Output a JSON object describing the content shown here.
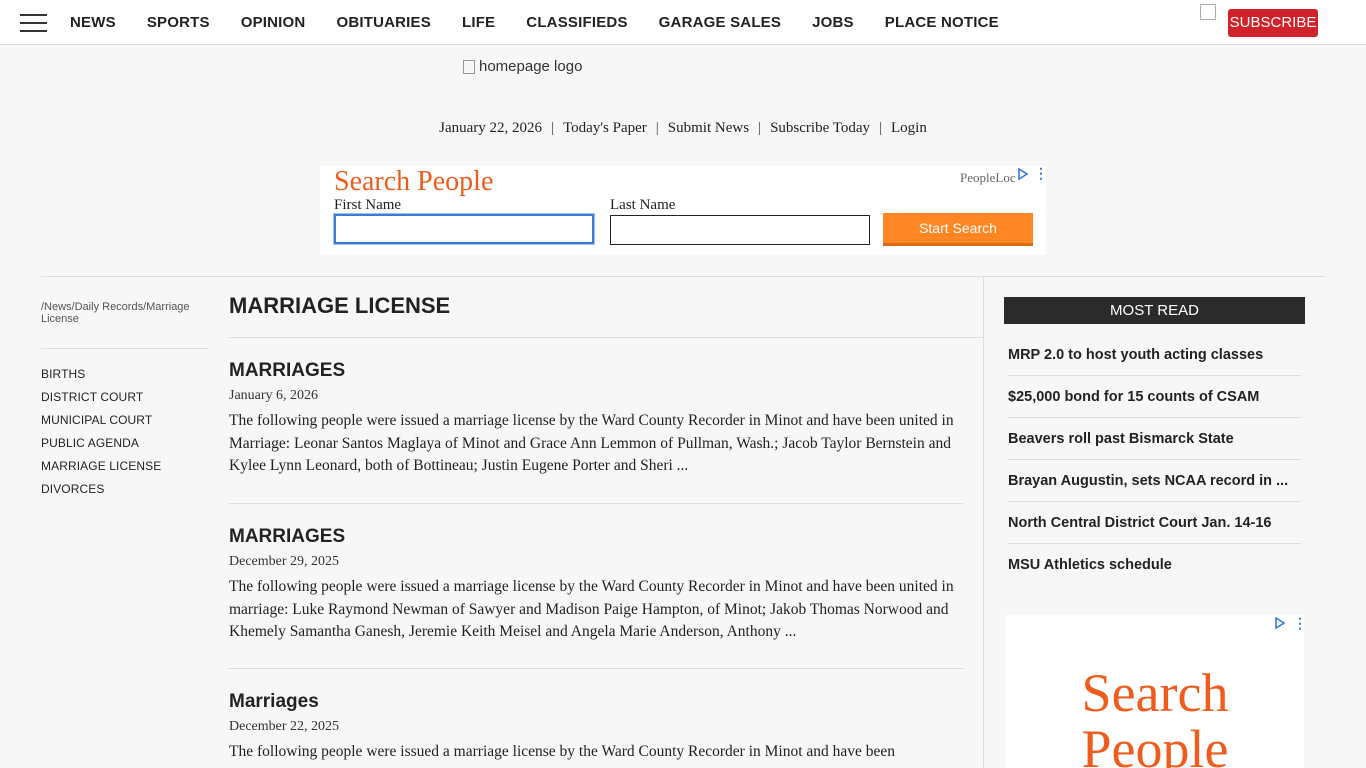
{
  "nav": {
    "items": [
      "NEWS",
      "SPORTS",
      "OPINION",
      "OBITUARIES",
      "LIFE",
      "CLASSIFIEDS",
      "GARAGE SALES",
      "JOBS",
      "PLACE NOTICE"
    ],
    "subscribe_label": "SUBSCRIBE"
  },
  "logo": {
    "alt_text": "homepage logo"
  },
  "utility": {
    "date": "January 22, 2026",
    "links": [
      "Today's Paper",
      "Submit News",
      "Subscribe Today",
      "Login"
    ]
  },
  "ad_top": {
    "title": "Search People",
    "brand": "PeopleLoc",
    "first_name_label": "First Name",
    "last_name_label": "Last Name",
    "first_name_value": "",
    "last_name_value": "",
    "button_label": "Start Search"
  },
  "breadcrumb": "/News/Daily Records/Marriage License",
  "sidenav": [
    "BIRTHS",
    "DISTRICT COURT",
    "MUNICIPAL COURT",
    "PUBLIC AGENDA",
    "MARRIAGE LICENSE",
    "DIVORCES"
  ],
  "page_title": "MARRIAGE LICENSE",
  "articles": [
    {
      "title": "MARRIAGES",
      "date": "January 6, 2026",
      "summary": "The following people were issued a marriage license by the Ward County Recorder in Minot and have been united in Marriage: Leonar Santos Maglaya of Minot and Grace Ann Lemmon of Pullman, Wash.; Jacob Taylor Bernstein and Kylee Lynn Leonard, both of Bottineau; Justin Eugene Porter and Sheri ..."
    },
    {
      "title": "MARRIAGES",
      "date": "December 29, 2025",
      "summary": "The following people were issued a marriage license by the Ward County Recorder in Minot and have been united in marriage: Luke Raymond Newman of Sawyer and Madison Paige Hampton, of Minot; Jakob Thomas Norwood and Khemely Samantha Ganesh, Jeremie Keith Meisel and Angela Marie Anderson, Anthony ..."
    },
    {
      "title": "Marriages",
      "date": "December 22, 2025",
      "summary": "The following people were issued a marriage license by the Ward County Recorder in Minot and have been"
    }
  ],
  "most_read": {
    "heading": "MOST READ",
    "items": [
      "MRP 2.0 to host youth acting classes",
      "$25,000 bond for 15 counts of CSAM",
      "Beavers roll past Bismarck State",
      "Brayan Augustin, sets NCAA record in ...",
      "North Central District Court Jan. 14-16",
      "MSU Athletics schedule"
    ]
  },
  "ad_side": {
    "title": "Search People"
  },
  "colors": {
    "accent": "#d1212a",
    "ad_orange": "#ee5d1e",
    "ad_button": "#ff8622"
  },
  "icons": [
    "menu-icon",
    "broken-image-icon",
    "ad-choices-icon",
    "ad-options-icon"
  ]
}
